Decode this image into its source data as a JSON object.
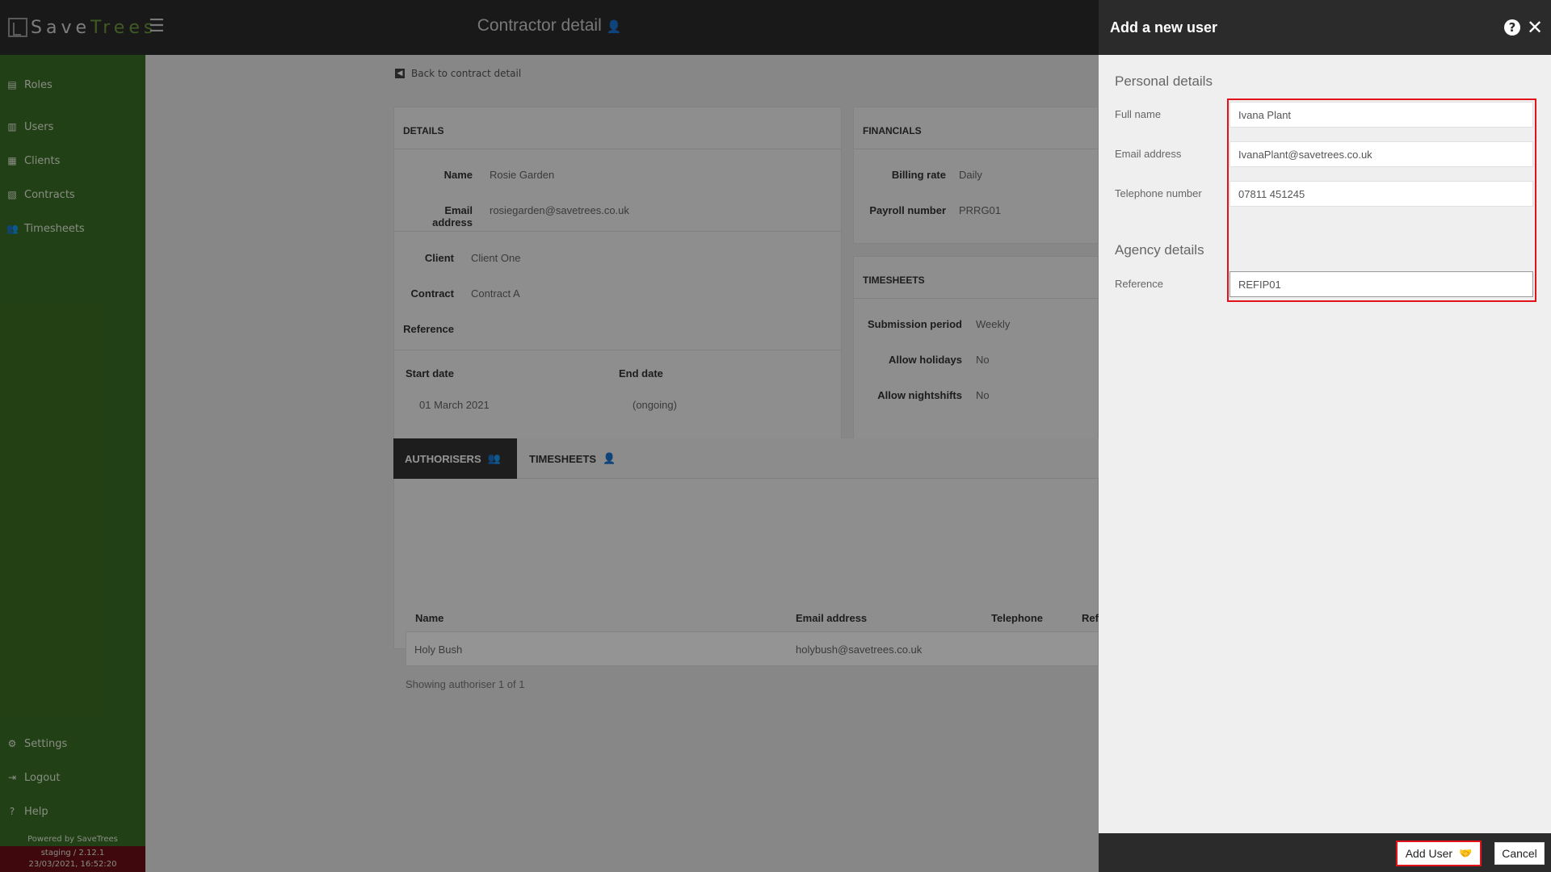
{
  "header": {
    "logo_save": "Save",
    "logo_trees": "Trees",
    "menu_icon": "hamburger-icon",
    "title": "Contractor detail",
    "title_icon": "user-icon"
  },
  "sidebar": {
    "items": [
      {
        "label": "Roles",
        "icon": "id-card-icon"
      },
      {
        "label": "Users",
        "icon": "file-icon"
      },
      {
        "label": "Clients",
        "icon": "building-icon"
      },
      {
        "label": "Contracts",
        "icon": "document-icon"
      },
      {
        "label": "Timesheets",
        "icon": "user-clock-icon"
      }
    ],
    "bottom_items": [
      {
        "label": "Settings",
        "icon": "gear-icon"
      },
      {
        "label": "Logout",
        "icon": "sign-out-icon"
      },
      {
        "label": "Help",
        "icon": "question-icon"
      }
    ],
    "powered_by": "Powered by SaveTrees",
    "environment": "staging / 2.12.1",
    "timestamp": "23/03/2021, 16:52:20"
  },
  "main": {
    "back_link": "Back to contract detail",
    "details": {
      "title": "DETAILS",
      "name_label": "Name",
      "name_value": "Rosie Garden",
      "email_label": "Email address",
      "email_value": "rosiegarden@savetrees.co.uk",
      "client_label": "Client",
      "client_value": "Client One",
      "contract_label": "Contract",
      "contract_value": "Contract A",
      "reference_label": "Reference",
      "start_label": "Start date",
      "start_value": "01 March 2021",
      "end_label": "End date",
      "end_value": "(ongoing)"
    },
    "financials": {
      "title": "FINANCIALS",
      "billing_label": "Billing rate",
      "billing_value": "Daily",
      "payroll_label": "Payroll number",
      "payroll_value": "PRRG01"
    },
    "timesheets": {
      "title": "TIMESHEETS",
      "submission_label": "Submission period",
      "submission_value": "Weekly",
      "holidays_label": "Allow holidays",
      "holidays_value": "No",
      "nightshifts_label": "Allow nightshifts",
      "nightshifts_value": "No"
    },
    "tabs": [
      {
        "label": "AUTHORISERS",
        "icon": "users-icon"
      },
      {
        "label": "TIMESHEETS",
        "icon": "user-clock-icon"
      }
    ],
    "table": {
      "headers": [
        "Name",
        "Email address",
        "Telephone",
        "Ref"
      ],
      "rows": [
        {
          "name": "Holy Bush",
          "email": "holybush@savetrees.co.uk",
          "telephone": "",
          "ref": ""
        }
      ],
      "showing": "Showing authoriser 1 of 1"
    }
  },
  "panel": {
    "title": "Add a new user",
    "personal_title": "Personal details",
    "full_name_label": "Full name",
    "full_name_value": "Ivana Plant",
    "email_label": "Email address",
    "email_value": "IvanaPlant@savetrees.co.uk",
    "telephone_label": "Telephone number",
    "telephone_value": "07811 451245",
    "agency_title": "Agency details",
    "reference_label": "Reference",
    "reference_value": "REFIP01",
    "add_button": "Add User",
    "cancel_button": "Cancel"
  },
  "colors": {
    "sidebar": "#3c6f25",
    "header": "#2b2b2b",
    "highlight": "#e3121a",
    "env_bar": "#6b0f18"
  }
}
